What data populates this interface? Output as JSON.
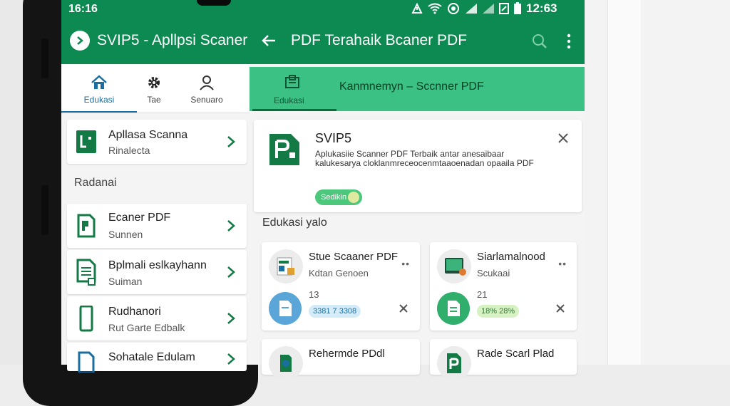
{
  "status_bar": {
    "time_left": "16:16",
    "time_right": "12:63"
  },
  "left_app": {
    "title": "SVIP5 - Apllpsi Scaner",
    "tabs": [
      {
        "label": "Edukasi",
        "icon": "home-icon"
      },
      {
        "label": "Tae",
        "icon": "gear-icon"
      },
      {
        "label": "Senuaro",
        "icon": "person-icon"
      }
    ],
    "top_item": {
      "title": "Apllasa Scanna",
      "subtitle": "Rinalecta"
    },
    "section_label": "Radanai",
    "items": [
      {
        "title": "Ecaner PDF",
        "subtitle": "Sunnen"
      },
      {
        "title": "Bplmali eslkayhann",
        "subtitle": "Suiman"
      },
      {
        "title": "Rudhanori",
        "subtitle": "Rut Garte Edbalk"
      },
      {
        "title": "Sohatale Edulam",
        "subtitle": ""
      }
    ]
  },
  "right_app": {
    "title": "PDF Terahaik Bcaner PDF",
    "sub_tab_label": "Edukasi",
    "sub_title": "Kanmnemyn  –  Sccnner PDF",
    "detail": {
      "name": "SVIP5",
      "description": "Aplukasiie Scanner PDF Terbaik antar anesaibaar kalukesarya cloklanmreceocenmtaaoenadan opaaila PDF",
      "badge": "Sedikin"
    },
    "section_label": "Edukasi yalo",
    "cards": [
      {
        "title": "Stue Scaaner PDF",
        "subtitle": "Kdtan Genoen",
        "number": "13",
        "pill": "3381 7 3308"
      },
      {
        "title": "Siarlamalnood",
        "subtitle": "Scukaai",
        "number": "21",
        "pill": "18% 28%"
      },
      {
        "title": "Rehermde PDdl",
        "subtitle": ""
      },
      {
        "title": "Rade Scarl Plad",
        "subtitle": ""
      }
    ]
  },
  "colors": {
    "primary_green": "#0d8a52",
    "accent_green": "#3cc184",
    "tab_active_blue": "#1a6fa0",
    "icon_green": "#137a45"
  }
}
